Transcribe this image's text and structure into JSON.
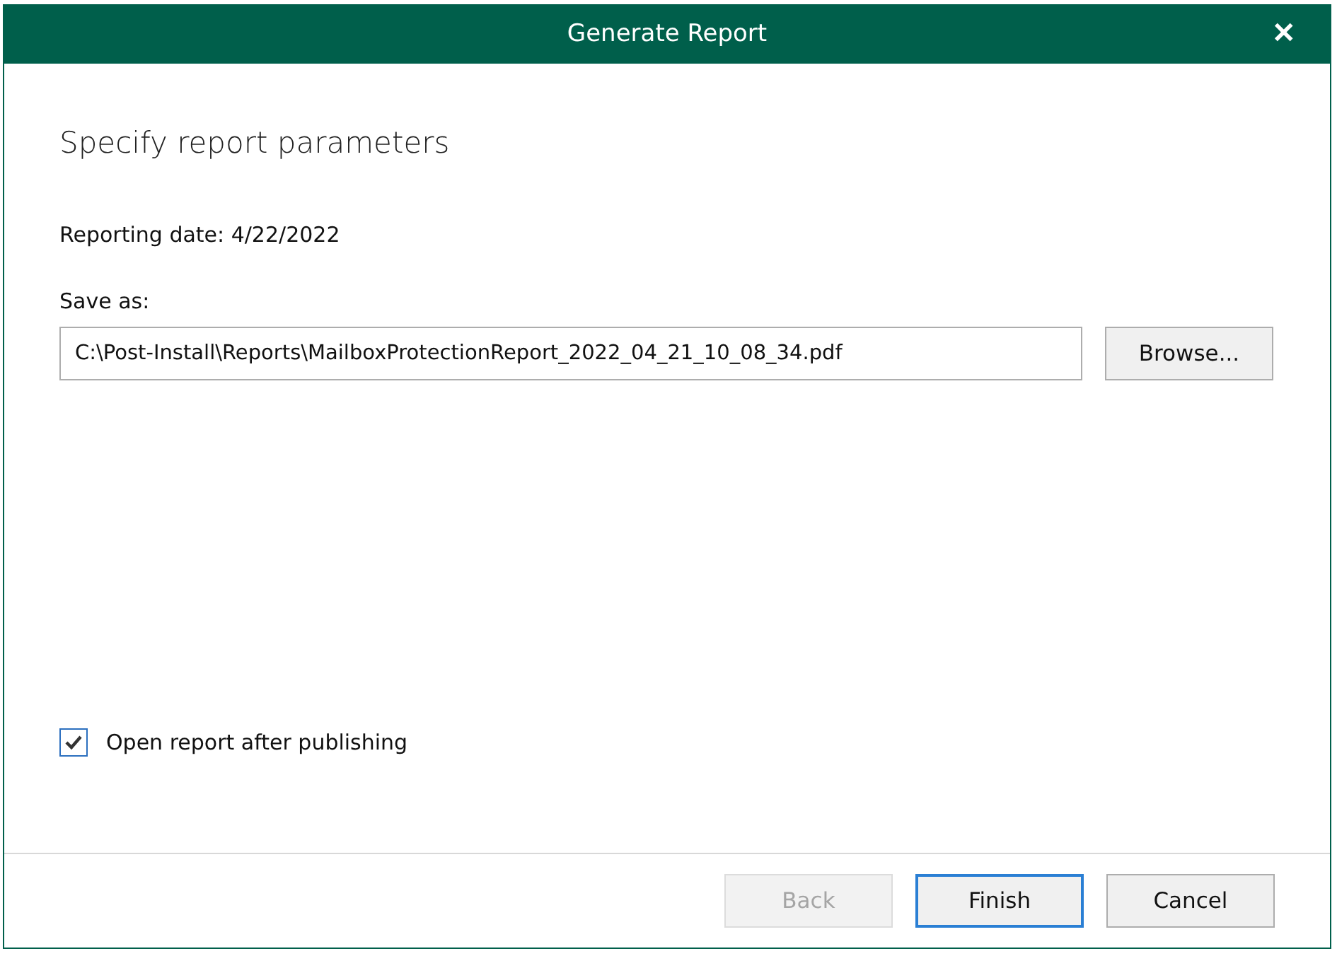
{
  "window": {
    "title": "Generate Report",
    "close": "✕"
  },
  "heading": "Specify report parameters",
  "reporting_date": "Reporting date: 4/22/2022",
  "save_as": {
    "label": "Save as:",
    "value": "C:\\Post-Install\\Reports\\MailboxProtectionReport_2022_04_21_10_08_34.pdf",
    "button": "Browse..."
  },
  "open_after": {
    "label": "Open report after publishing",
    "checked": true
  },
  "buttons": [
    {
      "label": "Back",
      "disabled": true,
      "default": false
    },
    {
      "label": "Finish",
      "disabled": false,
      "default": true
    },
    {
      "label": "Cancel",
      "disabled": false,
      "default": false
    }
  ]
}
